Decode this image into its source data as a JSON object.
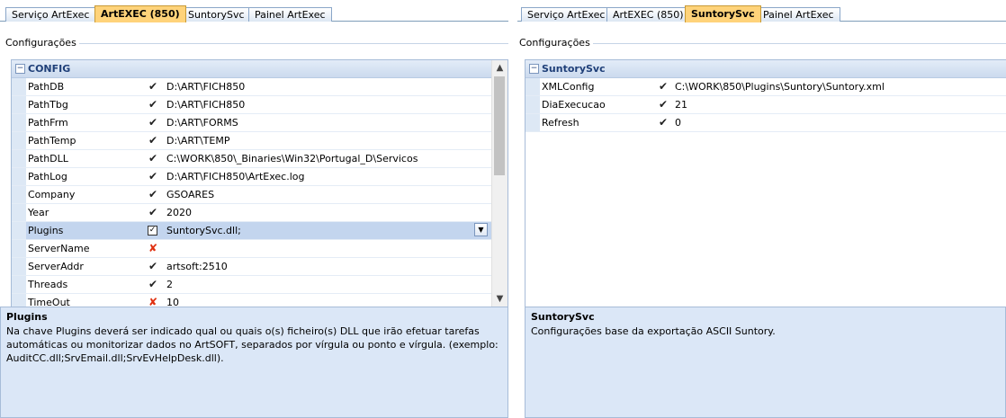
{
  "left": {
    "tabs": [
      {
        "label": "Serviço ArtExec",
        "active": false
      },
      {
        "label": "ArtEXEC (850)",
        "active": true
      },
      {
        "label": "SuntorySvc",
        "active": false
      },
      {
        "label": "Painel ArtExec",
        "active": false
      }
    ],
    "group_label": "Configurações",
    "category": "CONFIG",
    "properties": [
      {
        "name": "PathDB",
        "mark": "✔",
        "value": "D:\\ART\\FICH850"
      },
      {
        "name": "PathTbg",
        "mark": "✔",
        "value": "D:\\ART\\FICH850"
      },
      {
        "name": "PathFrm",
        "mark": "✔",
        "value": "D:\\ART\\FORMS"
      },
      {
        "name": "PathTemp",
        "mark": "✔",
        "value": "D:\\ART\\TEMP"
      },
      {
        "name": "PathDLL",
        "mark": "✔",
        "value": "C:\\WORK\\850\\_Binaries\\Win32\\Portugal_D\\Servicos"
      },
      {
        "name": "PathLog",
        "mark": "✔",
        "value": "D:\\ART\\FICH850\\ArtExec.log"
      },
      {
        "name": "Company",
        "mark": "✔",
        "value": "GSOARES"
      },
      {
        "name": "Year",
        "mark": "✔",
        "value": "2020"
      },
      {
        "name": "Plugins",
        "mark": "☑",
        "value": "SuntorySvc.dll;"
      },
      {
        "name": "ServerName",
        "mark": "✘",
        "value": ""
      },
      {
        "name": "ServerAddr",
        "mark": "✔",
        "value": "artsoft:2510"
      },
      {
        "name": "Threads",
        "mark": "✔",
        "value": "2"
      },
      {
        "name": "TimeOut",
        "mark": "✘",
        "value": "10"
      }
    ],
    "help": {
      "title": "Plugins",
      "text": "Na chave Plugins deverá ser indicado qual ou quais o(s) ficheiro(s) DLL que irão efetuar tarefas automáticas ou monitorizar dados no ArtSOFT, separados por vírgula ou ponto e vírgula. (exemplo: AuditCC.dll;SrvEmail.dll;SrvEvHelpDesk.dll)."
    }
  },
  "right": {
    "tabs": [
      {
        "label": "Serviço ArtExec",
        "active": false
      },
      {
        "label": "ArtEXEC (850)",
        "active": false
      },
      {
        "label": "SuntorySvc",
        "active": true
      },
      {
        "label": "Painel ArtExec",
        "active": false
      }
    ],
    "group_label": "Configurações",
    "category": "SuntorySvc",
    "properties": [
      {
        "name": "XMLConfig",
        "mark": "✔",
        "value": "C:\\WORK\\850\\Plugins\\Suntory\\Suntory.xml"
      },
      {
        "name": "DiaExecucao",
        "mark": "✔",
        "value": "21"
      },
      {
        "name": "Refresh",
        "mark": "✔",
        "value": "0"
      }
    ],
    "help": {
      "title": "SuntorySvc",
      "text": "Configurações base da exportação ASCII Suntory."
    }
  },
  "colors": {
    "active_tab": "#ffd37a",
    "category_bg": "#cbdaee",
    "help_bg": "#dbe7f7",
    "invalid_mark": "#e03010"
  },
  "icons": {
    "ok": "check-icon",
    "bad": "cross-icon",
    "checkbox": "checkbox-icon",
    "dropdown": "chevron-down-icon"
  }
}
